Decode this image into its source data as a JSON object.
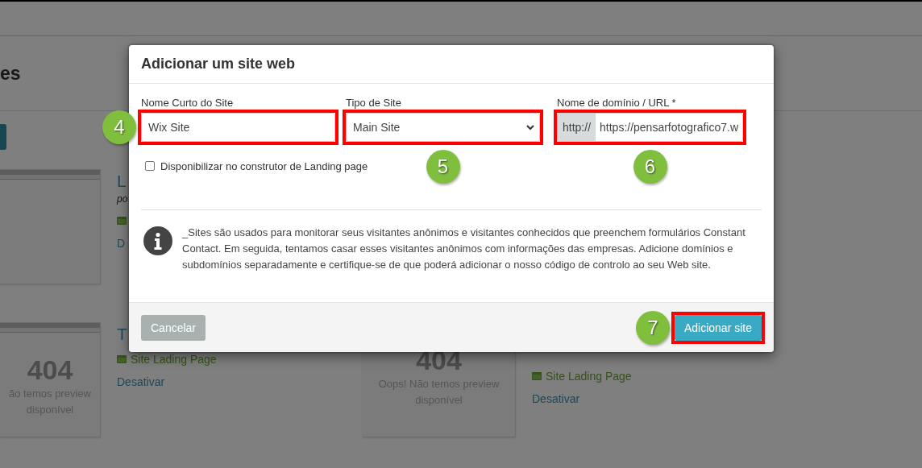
{
  "page": {
    "title": "es",
    "rows": [
      [
        {
          "kind": "preview",
          "browser_bar": true
        },
        {
          "kind": "info",
          "title": "L",
          "subtitle": "po",
          "landing_icon": true,
          "action": "D"
        }
      ],
      [
        {
          "kind": "preview",
          "browser_bar": true,
          "code": "404",
          "message": "ão temos preview",
          "message_2": "disponível"
        },
        {
          "kind": "info",
          "title": "T",
          "landing_icon": true,
          "landing": "Site Lading Page",
          "action": "Desativar"
        },
        {
          "kind": "preview",
          "browser_bar": false,
          "code": "404",
          "message": "Oops! Não temos preview",
          "message_2": "disponível"
        },
        {
          "kind": "info",
          "landing_icon": true,
          "landing": "Site Lading Page",
          "action": "Desativar"
        }
      ]
    ]
  },
  "dialog": {
    "title": "Adicionar um site web",
    "fields": [
      {
        "kind": "text",
        "label": "Nome Curto do Site",
        "value": "Wix Site",
        "highlighted": true,
        "callout": "4"
      },
      {
        "kind": "select",
        "label": "Tipo de Site",
        "value": "Main Site",
        "highlighted": true,
        "callout": "5"
      },
      {
        "kind": "url",
        "label": "Nome de domínio / URL *",
        "prefix": "http://",
        "value": "https://pensarfotografico7.w",
        "highlighted": true,
        "callout": "6"
      }
    ],
    "checkbox": {
      "label": "Disponibilizar no construtor de Landing page",
      "checked": false
    },
    "info": "_Sites são usados para monitorar seus visitantes anônimos e visitantes conhecidos que preenchem formulários Constant Contact. Em seguida, tentamos casar esses visitantes anônimos com informações das empresas. Adicione domínios e subdomínios separadamente e certifique-se de que poderá adicionar o nosso código de controlo ao seu Web site.",
    "buttons": [
      {
        "kind": "secondary",
        "label": "Cancelar",
        "highlighted": false
      },
      {
        "kind": "primary",
        "label": "Adicionar site",
        "highlighted": true,
        "callout": "7"
      }
    ]
  }
}
